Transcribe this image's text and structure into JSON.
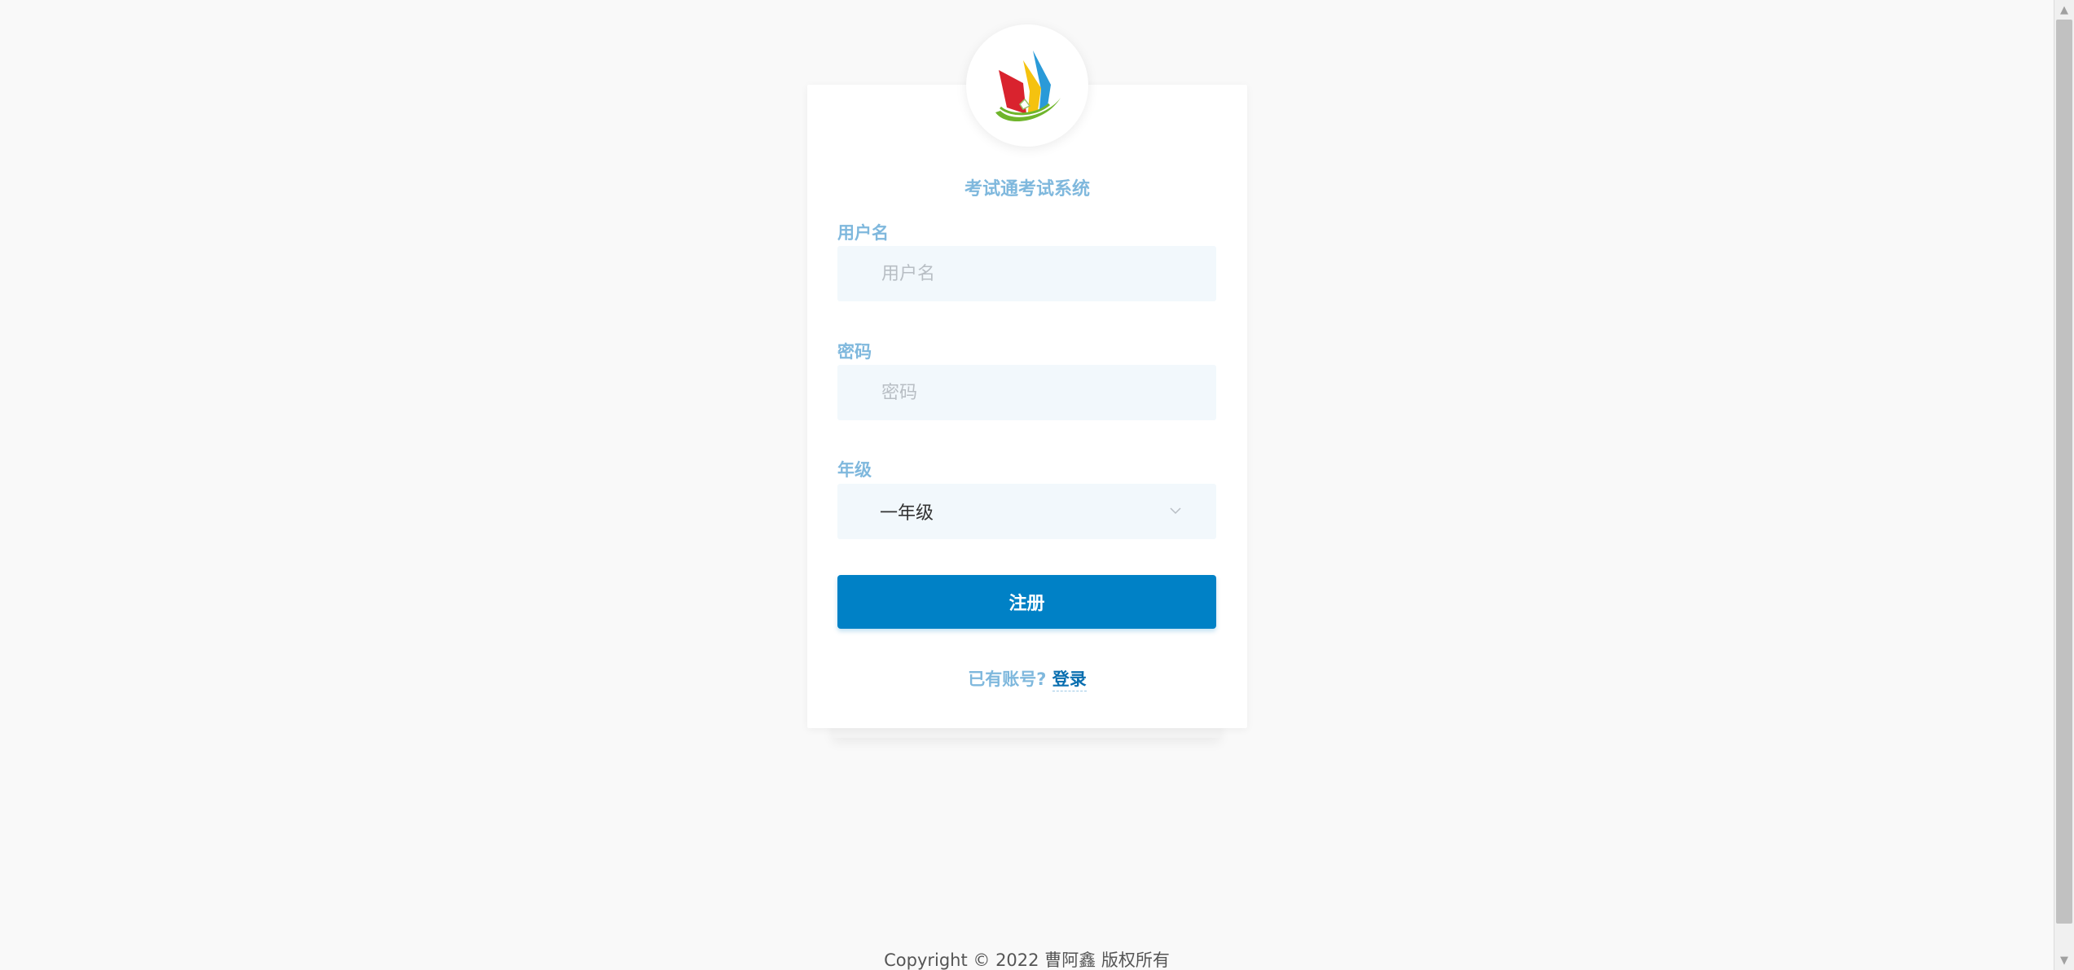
{
  "app_title": "考试通考试系统",
  "form": {
    "username": {
      "label": "用户名",
      "placeholder": "用户名",
      "value": ""
    },
    "password": {
      "label": "密码",
      "placeholder": "密码",
      "value": ""
    },
    "grade": {
      "label": "年级",
      "selected": "一年级"
    },
    "submit_label": "注册"
  },
  "login_prompt": {
    "text": "已有账号?",
    "link": "登录"
  },
  "footer": {
    "copyright": "Copyright © 2022 曹阿鑫 版权所有"
  },
  "colors": {
    "accent": "#0081c6",
    "label": "#7fb8dd",
    "input_bg": "#f2f8fc",
    "page_bg": "#f9f9f9"
  },
  "logo": {
    "icon": "book-logo-icon"
  }
}
